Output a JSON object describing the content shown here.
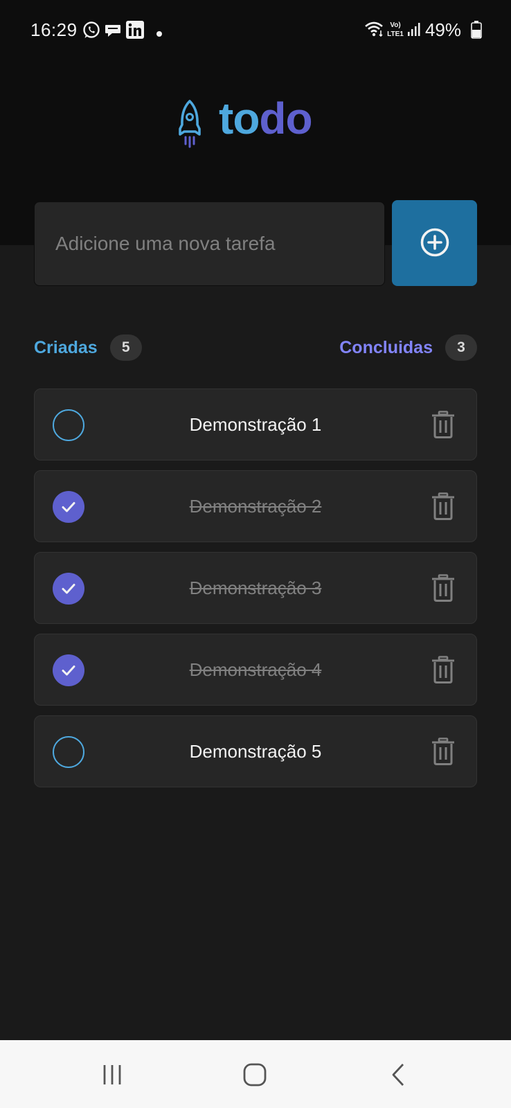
{
  "status_bar": {
    "time": "16:29",
    "battery_percent": "49%",
    "left_icons": [
      "whatsapp-icon",
      "message-bubble-icon",
      "linkedin-icon",
      "notification-dot-icon"
    ],
    "right_icons": [
      "wifi-icon",
      "volte-icon",
      "signal-icon",
      "battery-icon"
    ]
  },
  "logo": {
    "icon": "rocket-icon",
    "text_part1": "to",
    "text_part2": "do",
    "colors": {
      "part1": "#4ea8de",
      "part2": "#5e60ce"
    }
  },
  "new_task": {
    "placeholder": "Adicione uma nova tarefa",
    "value": "",
    "add_icon": "plus-circle-icon"
  },
  "counters": {
    "created_label": "Criadas",
    "created_count": "5",
    "done_label": "Concluidas",
    "done_count": "3"
  },
  "tasks": [
    {
      "text": "Demonstração 1",
      "done": false
    },
    {
      "text": "Demonstração 2",
      "done": true
    },
    {
      "text": "Demonstração 3",
      "done": true
    },
    {
      "text": "Demonstração 4",
      "done": true
    },
    {
      "text": "Demonstração 5",
      "done": false
    }
  ],
  "nav_bar": {
    "items": [
      "recent-apps-icon",
      "home-icon",
      "back-icon"
    ]
  },
  "colors": {
    "blue": "#4ea8de",
    "blue_dark": "#1e6f9f",
    "purple": "#5e60ce",
    "purple_light": "#8284fa",
    "background": "#1a1a1a",
    "header_background": "#0d0d0d",
    "card": "#262626"
  }
}
